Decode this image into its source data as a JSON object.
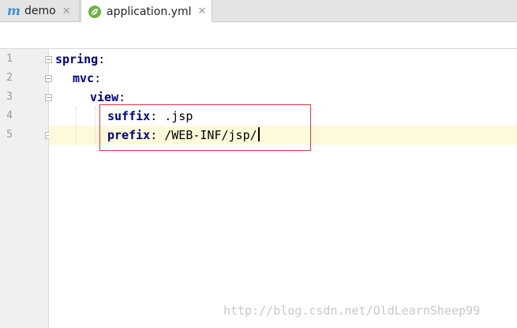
{
  "tabs": [
    {
      "label": "demo",
      "icon": "maven-m-icon",
      "active": false
    },
    {
      "label": "application.yml",
      "icon": "spring-leaf-icon",
      "active": true
    }
  ],
  "close_glyph": "✕",
  "gutter": {
    "line_numbers": [
      "1",
      "2",
      "3",
      "4",
      "5"
    ]
  },
  "code": {
    "lines": [
      {
        "key": "spring",
        "colon": ":",
        "value": ""
      },
      {
        "key": "mvc",
        "colon": ":",
        "value": ""
      },
      {
        "key": "view",
        "colon": ":",
        "value": ""
      },
      {
        "key": "suffix",
        "colon": ":",
        "value": " .jsp"
      },
      {
        "key": "prefix",
        "colon": ":",
        "value": " /WEB-INF/jsp/"
      }
    ]
  },
  "watermark": "http://blog.csdn.net/OldLearnSheep99",
  "colors": {
    "key": "#000080",
    "highlight_border": "#e0343f",
    "current_line": "#fcfad9"
  }
}
